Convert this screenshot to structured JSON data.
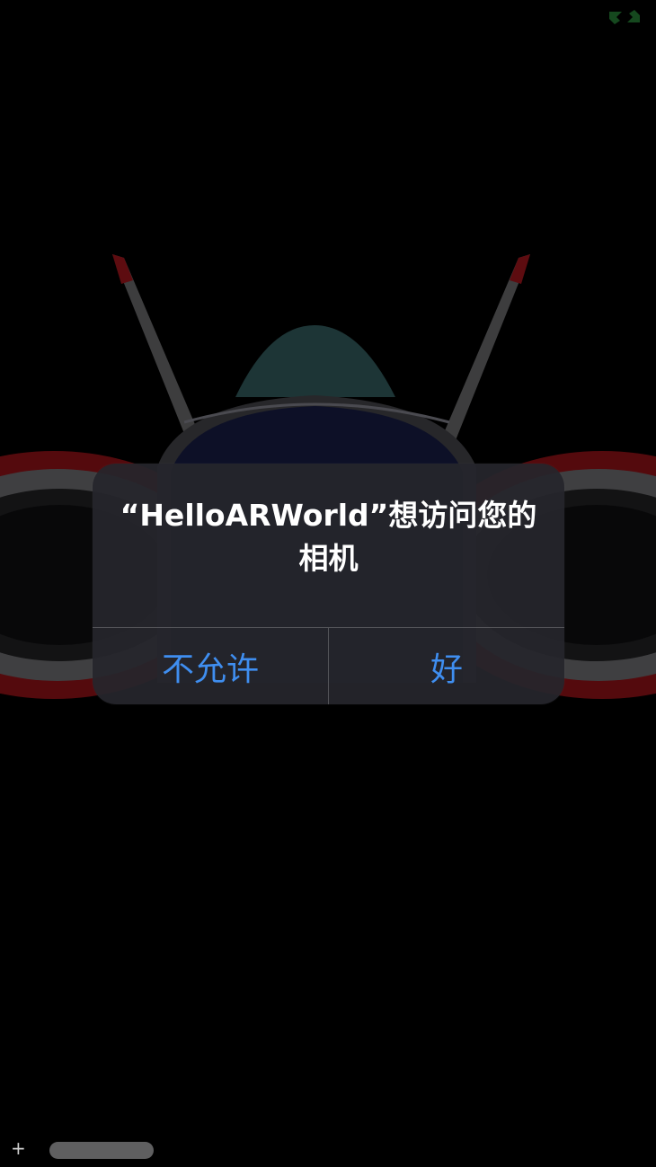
{
  "alert": {
    "message": "“HelloARWorld”想访问您的相机",
    "buttons": {
      "deny": "不允许",
      "allow": "好"
    }
  },
  "bottom_bar": {
    "plus_symbol": "+"
  },
  "colors": {
    "background": "#000000",
    "alert_background": "#26262c",
    "button_text": "#3f8ef0",
    "message_text": "#ffffff",
    "indicator_green": "#1f6b2d",
    "model_red": "#8a1218",
    "model_navy": "#14183a",
    "model_teal": "#2b4e50"
  },
  "icons": {
    "status": "split-arrows-icon",
    "scene": "3d-ship-model"
  }
}
